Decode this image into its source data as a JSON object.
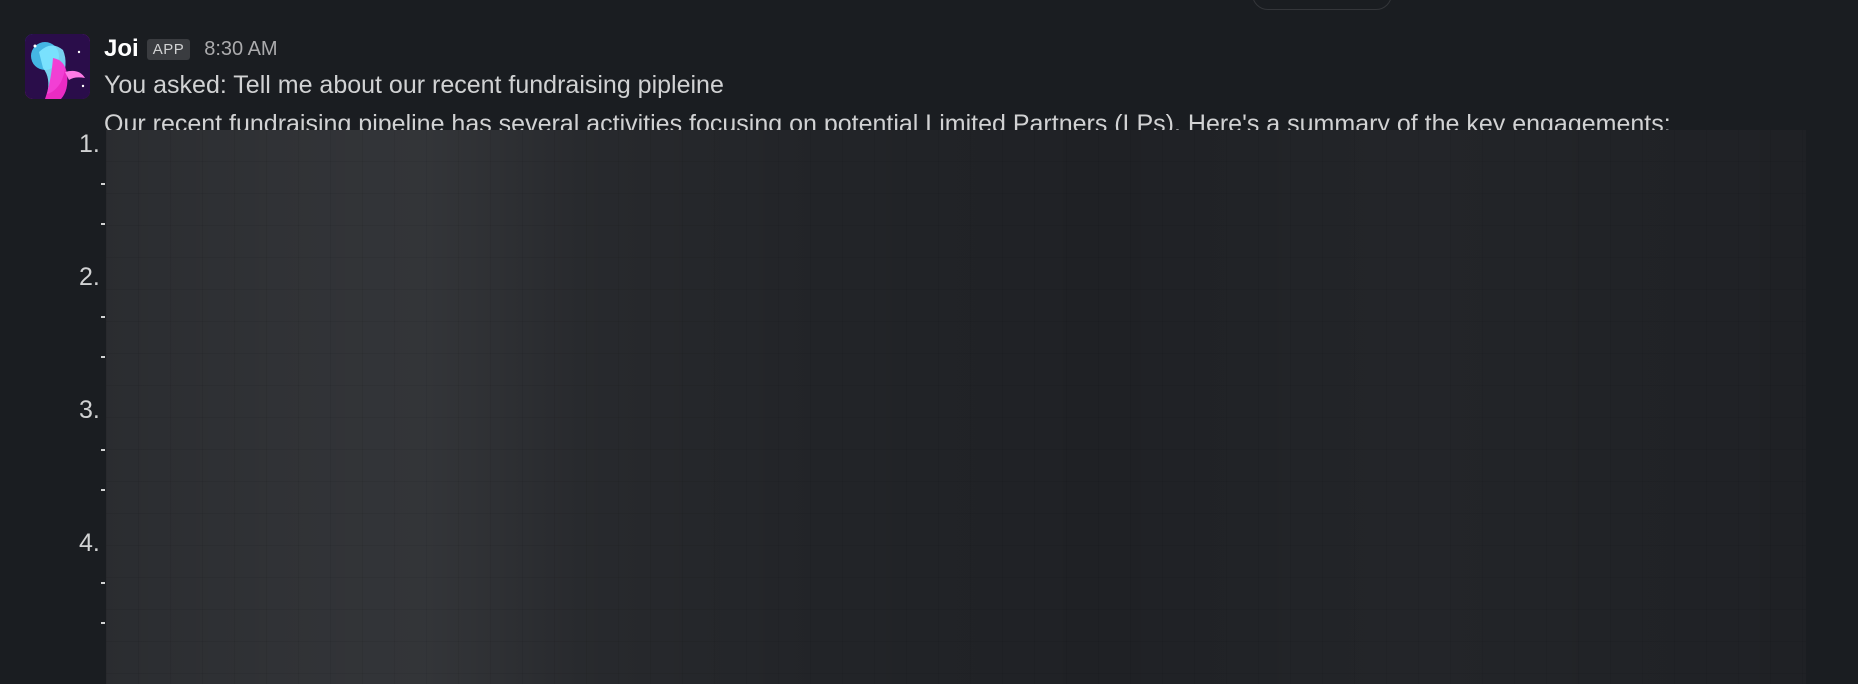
{
  "message": {
    "author": "Joi",
    "badge": "APP",
    "time": "8:30 AM",
    "asked": "You asked: Tell me about our recent fundraising pipleine",
    "summary": "Our recent fundraising pipeline has several activities focusing on potential Limited Partners (LPs). Here's a summary of the key engagements:",
    "list": {
      "items": [
        {
          "number": "1."
        },
        {
          "number": "2."
        },
        {
          "number": "3."
        },
        {
          "number": "4."
        }
      ]
    }
  },
  "colors": {
    "background": "#1a1d21",
    "text": "#d1d2d3",
    "author": "#ffffff",
    "timestamp": "#ababad",
    "badge_bg": "#3a3c40"
  },
  "icons": {
    "avatar": "joi-avatar"
  }
}
